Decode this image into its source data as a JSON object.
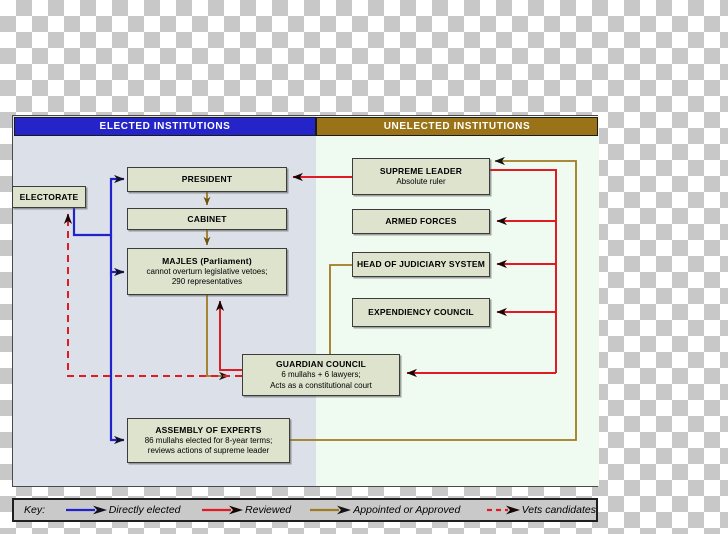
{
  "figure": {
    "headers": {
      "elected": "ELECTED INSTITUTIONS",
      "unelected": "UNELECTED INSTITUTIONS"
    },
    "colors": {
      "elected_header_bg": "#2424c8",
      "unelected_header_bg": "#9a7318",
      "elected_panel_bg": "#dce1e9",
      "unelected_panel_bg": "#effaf0",
      "box_fill": "#dde3cd",
      "directly_elected_line": "#2222cc",
      "reviewed_line": "#e01b24",
      "appointed_line": "#a07a20",
      "vets_line": "#e01b24"
    },
    "nodes": {
      "electorate": {
        "title": "ELECTORATE",
        "lines": []
      },
      "president": {
        "title": "PRESIDENT",
        "lines": []
      },
      "cabinet": {
        "title": "CABINET",
        "lines": []
      },
      "majles": {
        "title": "MAJLES (Parliament)",
        "lines": [
          "cannot overturn legislative vetoes;",
          "290 representatives"
        ]
      },
      "guardian_council": {
        "title": "GUARDIAN COUNCIL",
        "lines": [
          "6 mullahs + 6 lawyers;",
          "Acts as a constitutional court"
        ]
      },
      "assembly_of_experts": {
        "title": "ASSEMBLY OF EXPERTS",
        "lines": [
          "86 mullahs elected for 8-year terms;",
          "reviews actions of supreme leader"
        ]
      },
      "supreme_leader": {
        "title": "SUPREME LEADER",
        "lines": [
          "Absolute ruler"
        ]
      },
      "armed_forces": {
        "title": "ARMED FORCES",
        "lines": []
      },
      "head_of_judiciary": {
        "title": "HEAD OF JUDICIARY SYSTEM",
        "lines": []
      },
      "expediency_council": {
        "title": "EXPENDIENCY COUNCIL",
        "lines": []
      }
    }
  },
  "legend": {
    "key_label": "Key:",
    "items": [
      {
        "name": "directly-elected",
        "label": "Directly elected",
        "color": "#2222cc",
        "dashed": false
      },
      {
        "name": "reviewed",
        "label": "Reviewed",
        "color": "#e01b24",
        "dashed": false
      },
      {
        "name": "appointed-or-approved",
        "label": "Appointed or Approved",
        "color": "#a07a20",
        "dashed": false
      },
      {
        "name": "vets-candidates",
        "label": "Vets candidates",
        "color": "#e01b24",
        "dashed": true
      }
    ]
  }
}
